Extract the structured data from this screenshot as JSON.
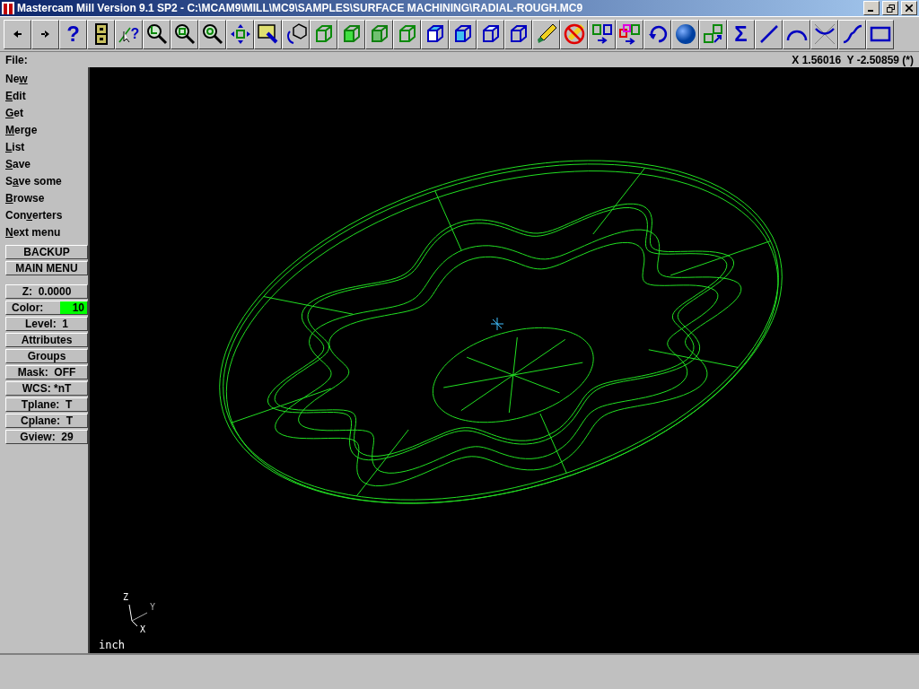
{
  "window": {
    "title": "Mastercam Mill Version 9.1 SP2 - C:\\MCAM9\\MILL\\MC9\\SAMPLES\\SURFACE MACHINING\\RADIAL-ROUGH.MC9"
  },
  "toolbar": [
    {
      "kind": "back"
    },
    {
      "kind": "forward"
    },
    {
      "kind": "help",
      "text": "?"
    },
    {
      "kind": "cabinet"
    },
    {
      "kind": "analyze",
      "text": "?"
    },
    {
      "kind": "zoom-window"
    },
    {
      "kind": "unzoom"
    },
    {
      "kind": "zoom-8"
    },
    {
      "kind": "pan"
    },
    {
      "kind": "paint"
    },
    {
      "kind": "rotate"
    },
    {
      "kind": "cube-green"
    },
    {
      "kind": "cube-green-light"
    },
    {
      "kind": "cube-green-mid"
    },
    {
      "kind": "cube-green"
    },
    {
      "kind": "cube-blue-top"
    },
    {
      "kind": "cube-blue-side"
    },
    {
      "kind": "cube-blue-front"
    },
    {
      "kind": "cube-blue"
    },
    {
      "kind": "pencil"
    },
    {
      "kind": "no-pencil"
    },
    {
      "kind": "translate"
    },
    {
      "kind": "translate-multi"
    },
    {
      "kind": "undo"
    },
    {
      "kind": "sphere"
    },
    {
      "kind": "cubes"
    },
    {
      "kind": "sigma",
      "text": "Σ"
    },
    {
      "kind": "line"
    },
    {
      "kind": "arc"
    },
    {
      "kind": "fillet"
    },
    {
      "kind": "spline"
    },
    {
      "kind": "rectangle"
    }
  ],
  "prompt": "File:",
  "coordinates": "X 1.56016  Y -2.50859 (*)",
  "menu": [
    {
      "pre": "Ne",
      "key": "w"
    },
    {
      "key": "E",
      "post": "dit"
    },
    {
      "key": "G",
      "post": "et"
    },
    {
      "key": "M",
      "post": "erge"
    },
    {
      "key": "L",
      "post": "ist"
    },
    {
      "key": "S",
      "post": "ave"
    },
    {
      "pre": "S",
      "key": "a",
      "post": "ve some"
    },
    {
      "key": "B",
      "post": "rowse"
    },
    {
      "pre": "Con",
      "key": "v",
      "post": "erters"
    },
    {
      "key": "N",
      "post": "ext menu"
    }
  ],
  "nav_buttons": [
    "BACKUP",
    "MAIN MENU"
  ],
  "status_buttons": [
    {
      "label": "Z:  0.0000"
    },
    {
      "label": "Color:",
      "value": "10",
      "color": "#00ff00"
    },
    {
      "label": "Level:  1"
    },
    {
      "label": "Attributes"
    },
    {
      "label": "Groups"
    },
    {
      "label": "Mask:  OFF"
    },
    {
      "label": "WCS: *nT"
    },
    {
      "label": "Tplane:  T"
    },
    {
      "label": "Cplane:  T"
    },
    {
      "label": "Gview:  29"
    }
  ],
  "axes": {
    "z": "Z",
    "y": "Y",
    "x": "X"
  },
  "units": "inch"
}
